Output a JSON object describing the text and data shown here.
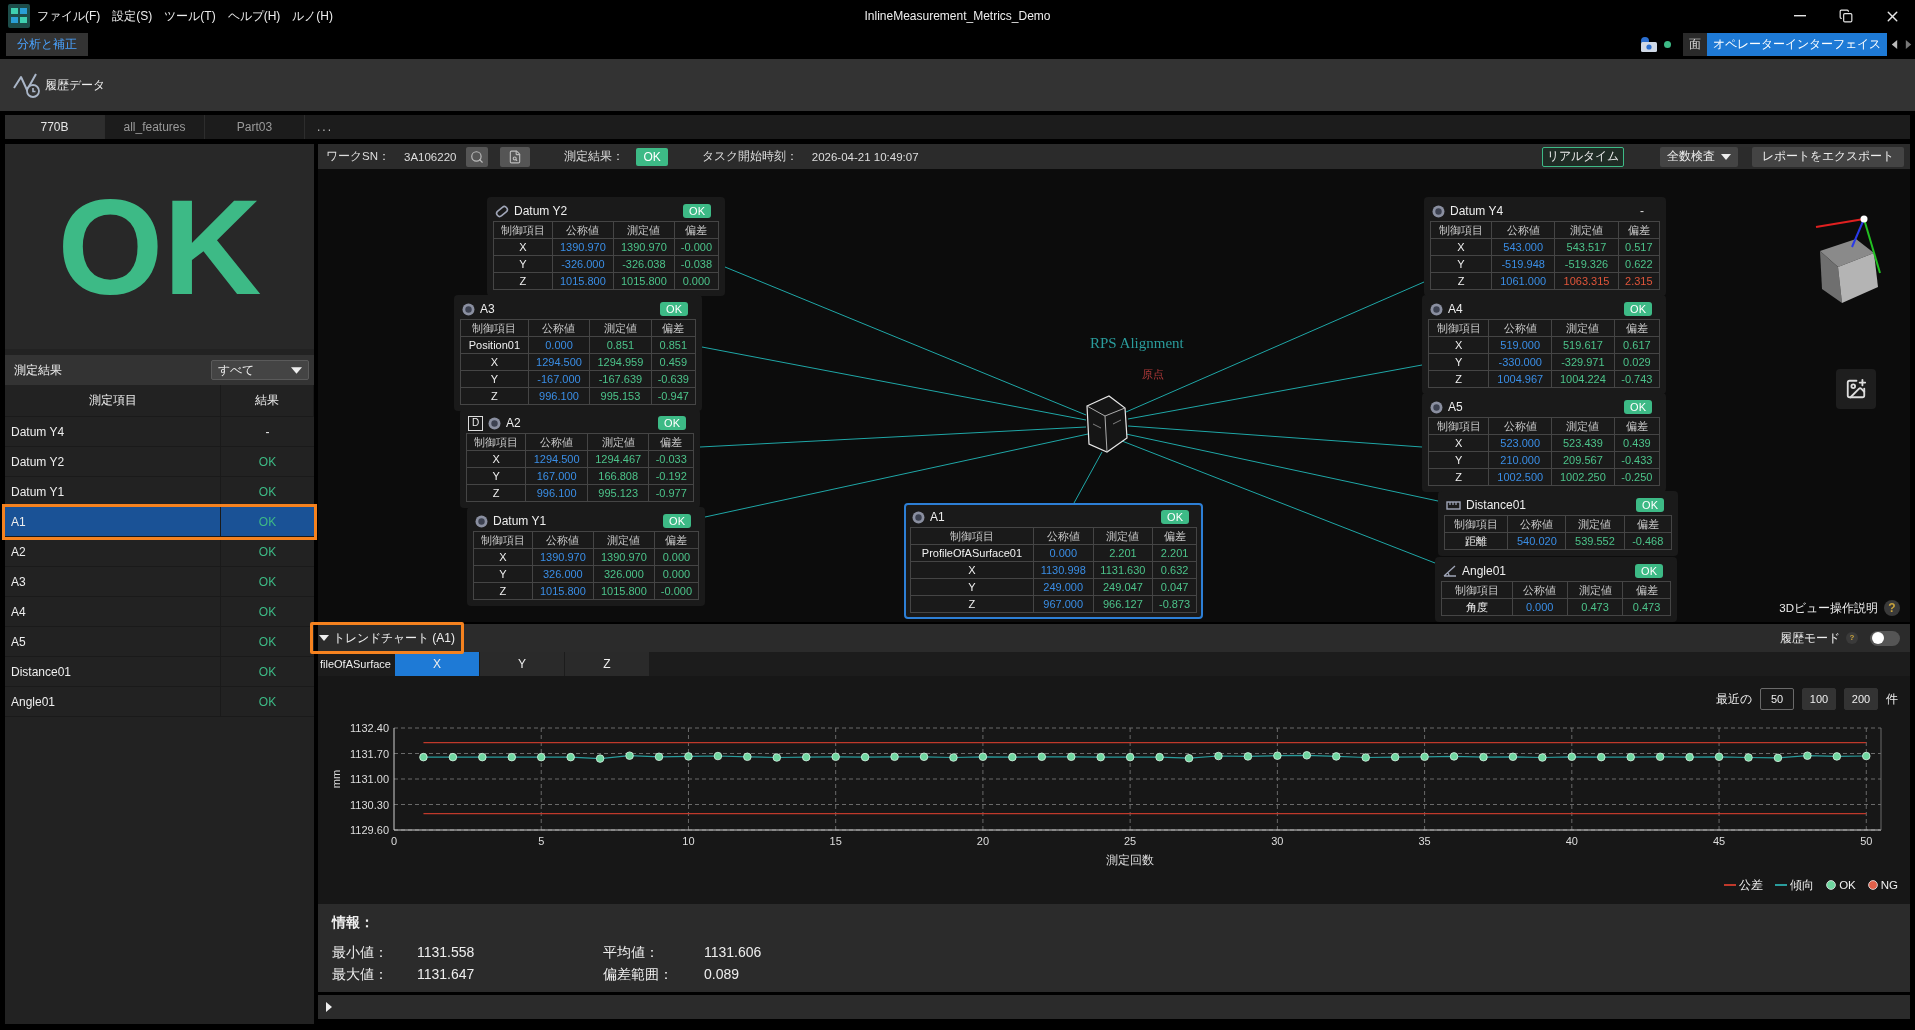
{
  "window": {
    "title": "InlineMeasurement_Metrics_Demo",
    "menu": [
      "ファイル(F)",
      "設定(S)",
      "ツール(T)",
      "ヘルプ(H)",
      "ルノ(H)"
    ]
  },
  "mode_tabs": {
    "left": [
      {
        "label": "分析と補正",
        "selected": true
      }
    ],
    "right": [
      {
        "label": "面",
        "selected": false
      },
      {
        "label": "オペレーターインターフェイス",
        "selected": true
      }
    ]
  },
  "connection": {
    "online": true
  },
  "toolbar": {
    "items": [
      {
        "label": "履歴データ"
      }
    ]
  },
  "project_tabs": {
    "tabs": [
      {
        "label": "770B",
        "selected": true
      },
      {
        "label": "all_features",
        "selected": false
      },
      {
        "label": "Part03",
        "selected": false
      }
    ],
    "overflow": "..."
  },
  "sidebar": {
    "overall_result": {
      "label": "OK",
      "kind": "ok"
    },
    "filter_label": "測定結果",
    "filter": {
      "value": "すべて"
    },
    "columns": [
      "測定項目",
      "結果"
    ],
    "rows": [
      {
        "name": "Datum Y4",
        "result": "-",
        "kind": "none",
        "selected": false
      },
      {
        "name": "Datum Y2",
        "result": "OK",
        "kind": "ok",
        "selected": false
      },
      {
        "name": "Datum Y1",
        "result": "OK",
        "kind": "ok",
        "selected": false
      },
      {
        "name": "A1",
        "result": "OK",
        "kind": "ok",
        "selected": true
      },
      {
        "name": "A2",
        "result": "OK",
        "kind": "ok",
        "selected": false
      },
      {
        "name": "A3",
        "result": "OK",
        "kind": "ok",
        "selected": false
      },
      {
        "name": "A4",
        "result": "OK",
        "kind": "ok",
        "selected": false
      },
      {
        "name": "A5",
        "result": "OK",
        "kind": "ok",
        "selected": false
      },
      {
        "name": "Distance01",
        "result": "OK",
        "kind": "ok",
        "selected": false
      },
      {
        "name": "Angle01",
        "result": "OK",
        "kind": "ok",
        "selected": false
      }
    ]
  },
  "work_bar": {
    "sn_label": "ワークSN：",
    "sn": "3A106220",
    "result_label": "測定結果：",
    "result": {
      "label": "OK",
      "kind": "ok"
    },
    "time_label": "タスク開始時刻：",
    "time": "2026-04-21 10:49:07",
    "realtime": {
      "label": "リアルタイム",
      "on": true
    },
    "inspection": "全数検査",
    "export": "レポートをエクスポート"
  },
  "viewer": {
    "alignment_label": "RPS Alignment",
    "origin_label": "原点",
    "panels": [
      {
        "title": "Datum Y2",
        "kind": "slot",
        "status": {
          "label": "OK",
          "kind": "ok"
        },
        "selected": false,
        "columns": [
          "制御項目",
          "公称値",
          "測定値",
          "偏差"
        ],
        "rows": [
          {
            "label": "X",
            "nominal": "1390.970",
            "measured": "1390.970",
            "deviation": "-0.000",
            "ng": false
          },
          {
            "label": "Y",
            "nominal": "-326.000",
            "measured": "-326.038",
            "deviation": "-0.038",
            "ng": false
          },
          {
            "label": "Z",
            "nominal": "1015.800",
            "measured": "1015.800",
            "deviation": "0.000",
            "ng": false
          }
        ]
      },
      {
        "title": "A3",
        "kind": "hole",
        "status": {
          "label": "OK",
          "kind": "ok"
        },
        "selected": false,
        "columns": [
          "制御項目",
          "公称値",
          "測定値",
          "偏差"
        ],
        "rows": [
          {
            "label": "Position01",
            "nominal": "0.000",
            "measured": "0.851",
            "deviation": "0.851",
            "ng": false
          },
          {
            "label": "X",
            "nominal": "1294.500",
            "measured": "1294.959",
            "deviation": "0.459",
            "ng": false
          },
          {
            "label": "Y",
            "nominal": "-167.000",
            "measured": "-167.639",
            "deviation": "-0.639",
            "ng": false
          },
          {
            "label": "Z",
            "nominal": "996.100",
            "measured": "995.153",
            "deviation": "-0.947",
            "ng": false
          }
        ]
      },
      {
        "title": "A2",
        "kind": "hole",
        "marker": "D",
        "status": {
          "label": "OK",
          "kind": "ok"
        },
        "selected": false,
        "columns": [
          "制御項目",
          "公称値",
          "測定値",
          "偏差"
        ],
        "rows": [
          {
            "label": "X",
            "nominal": "1294.500",
            "measured": "1294.467",
            "deviation": "-0.033",
            "ng": false
          },
          {
            "label": "Y",
            "nominal": "167.000",
            "measured": "166.808",
            "deviation": "-0.192",
            "ng": false
          },
          {
            "label": "Z",
            "nominal": "996.100",
            "measured": "995.123",
            "deviation": "-0.977",
            "ng": false
          }
        ]
      },
      {
        "title": "Datum Y1",
        "kind": "hole",
        "status": {
          "label": "OK",
          "kind": "ok"
        },
        "selected": false,
        "columns": [
          "制御項目",
          "公称値",
          "測定値",
          "偏差"
        ],
        "rows": [
          {
            "label": "X",
            "nominal": "1390.970",
            "measured": "1390.970",
            "deviation": "0.000",
            "ng": false
          },
          {
            "label": "Y",
            "nominal": "326.000",
            "measured": "326.000",
            "deviation": "0.000",
            "ng": false
          },
          {
            "label": "Z",
            "nominal": "1015.800",
            "measured": "1015.800",
            "deviation": "-0.000",
            "ng": false
          }
        ]
      },
      {
        "title": "A1",
        "kind": "hole",
        "status": {
          "label": "OK",
          "kind": "ok"
        },
        "selected": true,
        "columns": [
          "制御項目",
          "公称値",
          "測定値",
          "偏差"
        ],
        "rows": [
          {
            "label": "ProfileOfASurface01",
            "nominal": "0.000",
            "measured": "2.201",
            "deviation": "2.201",
            "ng": false
          },
          {
            "label": "X",
            "nominal": "1130.998",
            "measured": "1131.630",
            "deviation": "0.632",
            "ng": false
          },
          {
            "label": "Y",
            "nominal": "249.000",
            "measured": "249.047",
            "deviation": "0.047",
            "ng": false
          },
          {
            "label": "Z",
            "nominal": "967.000",
            "measured": "966.127",
            "deviation": "-0.873",
            "ng": false
          }
        ]
      },
      {
        "title": "Datum Y4",
        "kind": "hole",
        "status": {
          "label": "-",
          "kind": "none"
        },
        "selected": false,
        "columns": [
          "制御項目",
          "公称値",
          "測定値",
          "偏差"
        ],
        "rows": [
          {
            "label": "X",
            "nominal": "543.000",
            "measured": "543.517",
            "deviation": "0.517",
            "ng": false
          },
          {
            "label": "Y",
            "nominal": "-519.948",
            "measured": "-519.326",
            "deviation": "0.622",
            "ng": false
          },
          {
            "label": "Z",
            "nominal": "1061.000",
            "measured": "1063.315",
            "deviation": "2.315",
            "ng": true
          }
        ]
      },
      {
        "title": "A4",
        "kind": "hole",
        "status": {
          "label": "OK",
          "kind": "ok"
        },
        "selected": false,
        "columns": [
          "制御項目",
          "公称値",
          "測定値",
          "偏差"
        ],
        "rows": [
          {
            "label": "X",
            "nominal": "519.000",
            "measured": "519.617",
            "deviation": "0.617",
            "ng": false
          },
          {
            "label": "Y",
            "nominal": "-330.000",
            "measured": "-329.971",
            "deviation": "0.029",
            "ng": false
          },
          {
            "label": "Z",
            "nominal": "1004.967",
            "measured": "1004.224",
            "deviation": "-0.743",
            "ng": false
          }
        ]
      },
      {
        "title": "A5",
        "kind": "hole",
        "status": {
          "label": "OK",
          "kind": "ok"
        },
        "selected": false,
        "columns": [
          "制御項目",
          "公称値",
          "測定値",
          "偏差"
        ],
        "rows": [
          {
            "label": "X",
            "nominal": "523.000",
            "measured": "523.439",
            "deviation": "0.439",
            "ng": false
          },
          {
            "label": "Y",
            "nominal": "210.000",
            "measured": "209.567",
            "deviation": "-0.433",
            "ng": false
          },
          {
            "label": "Z",
            "nominal": "1002.500",
            "measured": "1002.250",
            "deviation": "-0.250",
            "ng": false
          }
        ]
      },
      {
        "title": "Distance01",
        "kind": "distance",
        "status": {
          "label": "OK",
          "kind": "ok"
        },
        "selected": false,
        "columns": [
          "制御項目",
          "公称値",
          "測定値",
          "偏差"
        ],
        "rows": [
          {
            "label": "距離",
            "nominal": "540.020",
            "measured": "539.552",
            "deviation": "-0.468",
            "ng": false
          }
        ]
      },
      {
        "title": "Angle01",
        "kind": "angle",
        "status": {
          "label": "OK",
          "kind": "ok"
        },
        "selected": false,
        "columns": [
          "制御項目",
          "公称値",
          "測定値",
          "偏差"
        ],
        "rows": [
          {
            "label": "角度",
            "nominal": "0.000",
            "measured": "0.473",
            "deviation": "0.473",
            "ng": false
          }
        ]
      }
    ],
    "help": {
      "label": "3Dビュー操作説明",
      "icon": "?"
    }
  },
  "trend": {
    "title": "トレンドチャート (A1)",
    "expanded": true,
    "highlighted": true,
    "history_mode": {
      "label": "履歴モード",
      "help": "?",
      "on": false
    },
    "feature": "fileOfASurface",
    "axis_tabs": [
      {
        "label": "X",
        "selected": true
      },
      {
        "label": "Y",
        "selected": false
      },
      {
        "label": "Z",
        "selected": false
      }
    ],
    "recent_label": "最近の",
    "recent_options": [
      {
        "label": "50",
        "selected": true
      },
      {
        "label": "100",
        "selected": false
      },
      {
        "label": "200",
        "selected": false
      }
    ],
    "recent_unit": "件",
    "chart_data": {
      "type": "line",
      "xlabel": "測定回数",
      "ylabel": "mm",
      "x": [
        1,
        2,
        3,
        4,
        5,
        6,
        7,
        8,
        9,
        10,
        11,
        12,
        13,
        14,
        15,
        16,
        17,
        18,
        19,
        20,
        21,
        22,
        23,
        24,
        25,
        26,
        27,
        28,
        29,
        30,
        31,
        32,
        33,
        34,
        35,
        36,
        37,
        38,
        39,
        40,
        41,
        42,
        43,
        44,
        45,
        46,
        47,
        48,
        49,
        50
      ],
      "values": [
        1131.6,
        1131.6,
        1131.6,
        1131.6,
        1131.6,
        1131.6,
        1131.56,
        1131.64,
        1131.61,
        1131.62,
        1131.63,
        1131.61,
        1131.59,
        1131.6,
        1131.61,
        1131.6,
        1131.61,
        1131.61,
        1131.59,
        1131.61,
        1131.6,
        1131.61,
        1131.61,
        1131.6,
        1131.6,
        1131.6,
        1131.57,
        1131.63,
        1131.62,
        1131.64,
        1131.65,
        1131.62,
        1131.59,
        1131.6,
        1131.61,
        1131.62,
        1131.6,
        1131.61,
        1131.59,
        1131.61,
        1131.6,
        1131.6,
        1131.61,
        1131.6,
        1131.61,
        1131.59,
        1131.58,
        1131.64,
        1131.62,
        1131.63
      ],
      "xlim": [
        0,
        50.5
      ],
      "ylim": [
        1129.6,
        1132.4
      ],
      "xticks": [
        {
          "value": 0,
          "label": "0"
        },
        {
          "value": 5,
          "label": "5"
        },
        {
          "value": 10,
          "label": "10"
        },
        {
          "value": 15,
          "label": "15"
        },
        {
          "value": 20,
          "label": "20"
        },
        {
          "value": 25,
          "label": "25"
        },
        {
          "value": 30,
          "label": "30"
        },
        {
          "value": 35,
          "label": "35"
        },
        {
          "value": 40,
          "label": "40"
        },
        {
          "value": 45,
          "label": "45"
        },
        {
          "value": 50,
          "label": "50"
        }
      ],
      "yticks": [
        {
          "value": 1129.6,
          "label": "1129.60"
        },
        {
          "value": 1130.3,
          "label": "1130.30"
        },
        {
          "value": 1131.0,
          "label": "1131.00"
        },
        {
          "value": 1131.7,
          "label": "1131.70"
        },
        {
          "value": 1132.4,
          "label": "1132.40"
        }
      ],
      "grid": true,
      "marker": "o",
      "ref_lines": [
        {
          "axis": "y",
          "value": 1132.0
        },
        {
          "axis": "y",
          "value": 1130.05
        }
      ]
    },
    "legend": [
      {
        "label": "公差",
        "kind": "tolerance",
        "color": "#c0392b"
      },
      {
        "label": "傾向",
        "kind": "trend",
        "color": "#2a9d9d"
      },
      {
        "label": "OK",
        "kind": "ok",
        "color": "#6fd6a0"
      },
      {
        "label": "NG",
        "kind": "ng",
        "color": "#e0604a"
      }
    ],
    "info": {
      "title": "情報：",
      "stats": [
        {
          "label": "最小値：",
          "value": "1131.558"
        },
        {
          "label": "平均値：",
          "value": "1131.606"
        },
        {
          "label": "最大値：",
          "value": "1131.647"
        },
        {
          "label": "偏差範囲：",
          "value": "0.089"
        }
      ]
    }
  },
  "bottom_panel": {
    "expanded": false
  }
}
